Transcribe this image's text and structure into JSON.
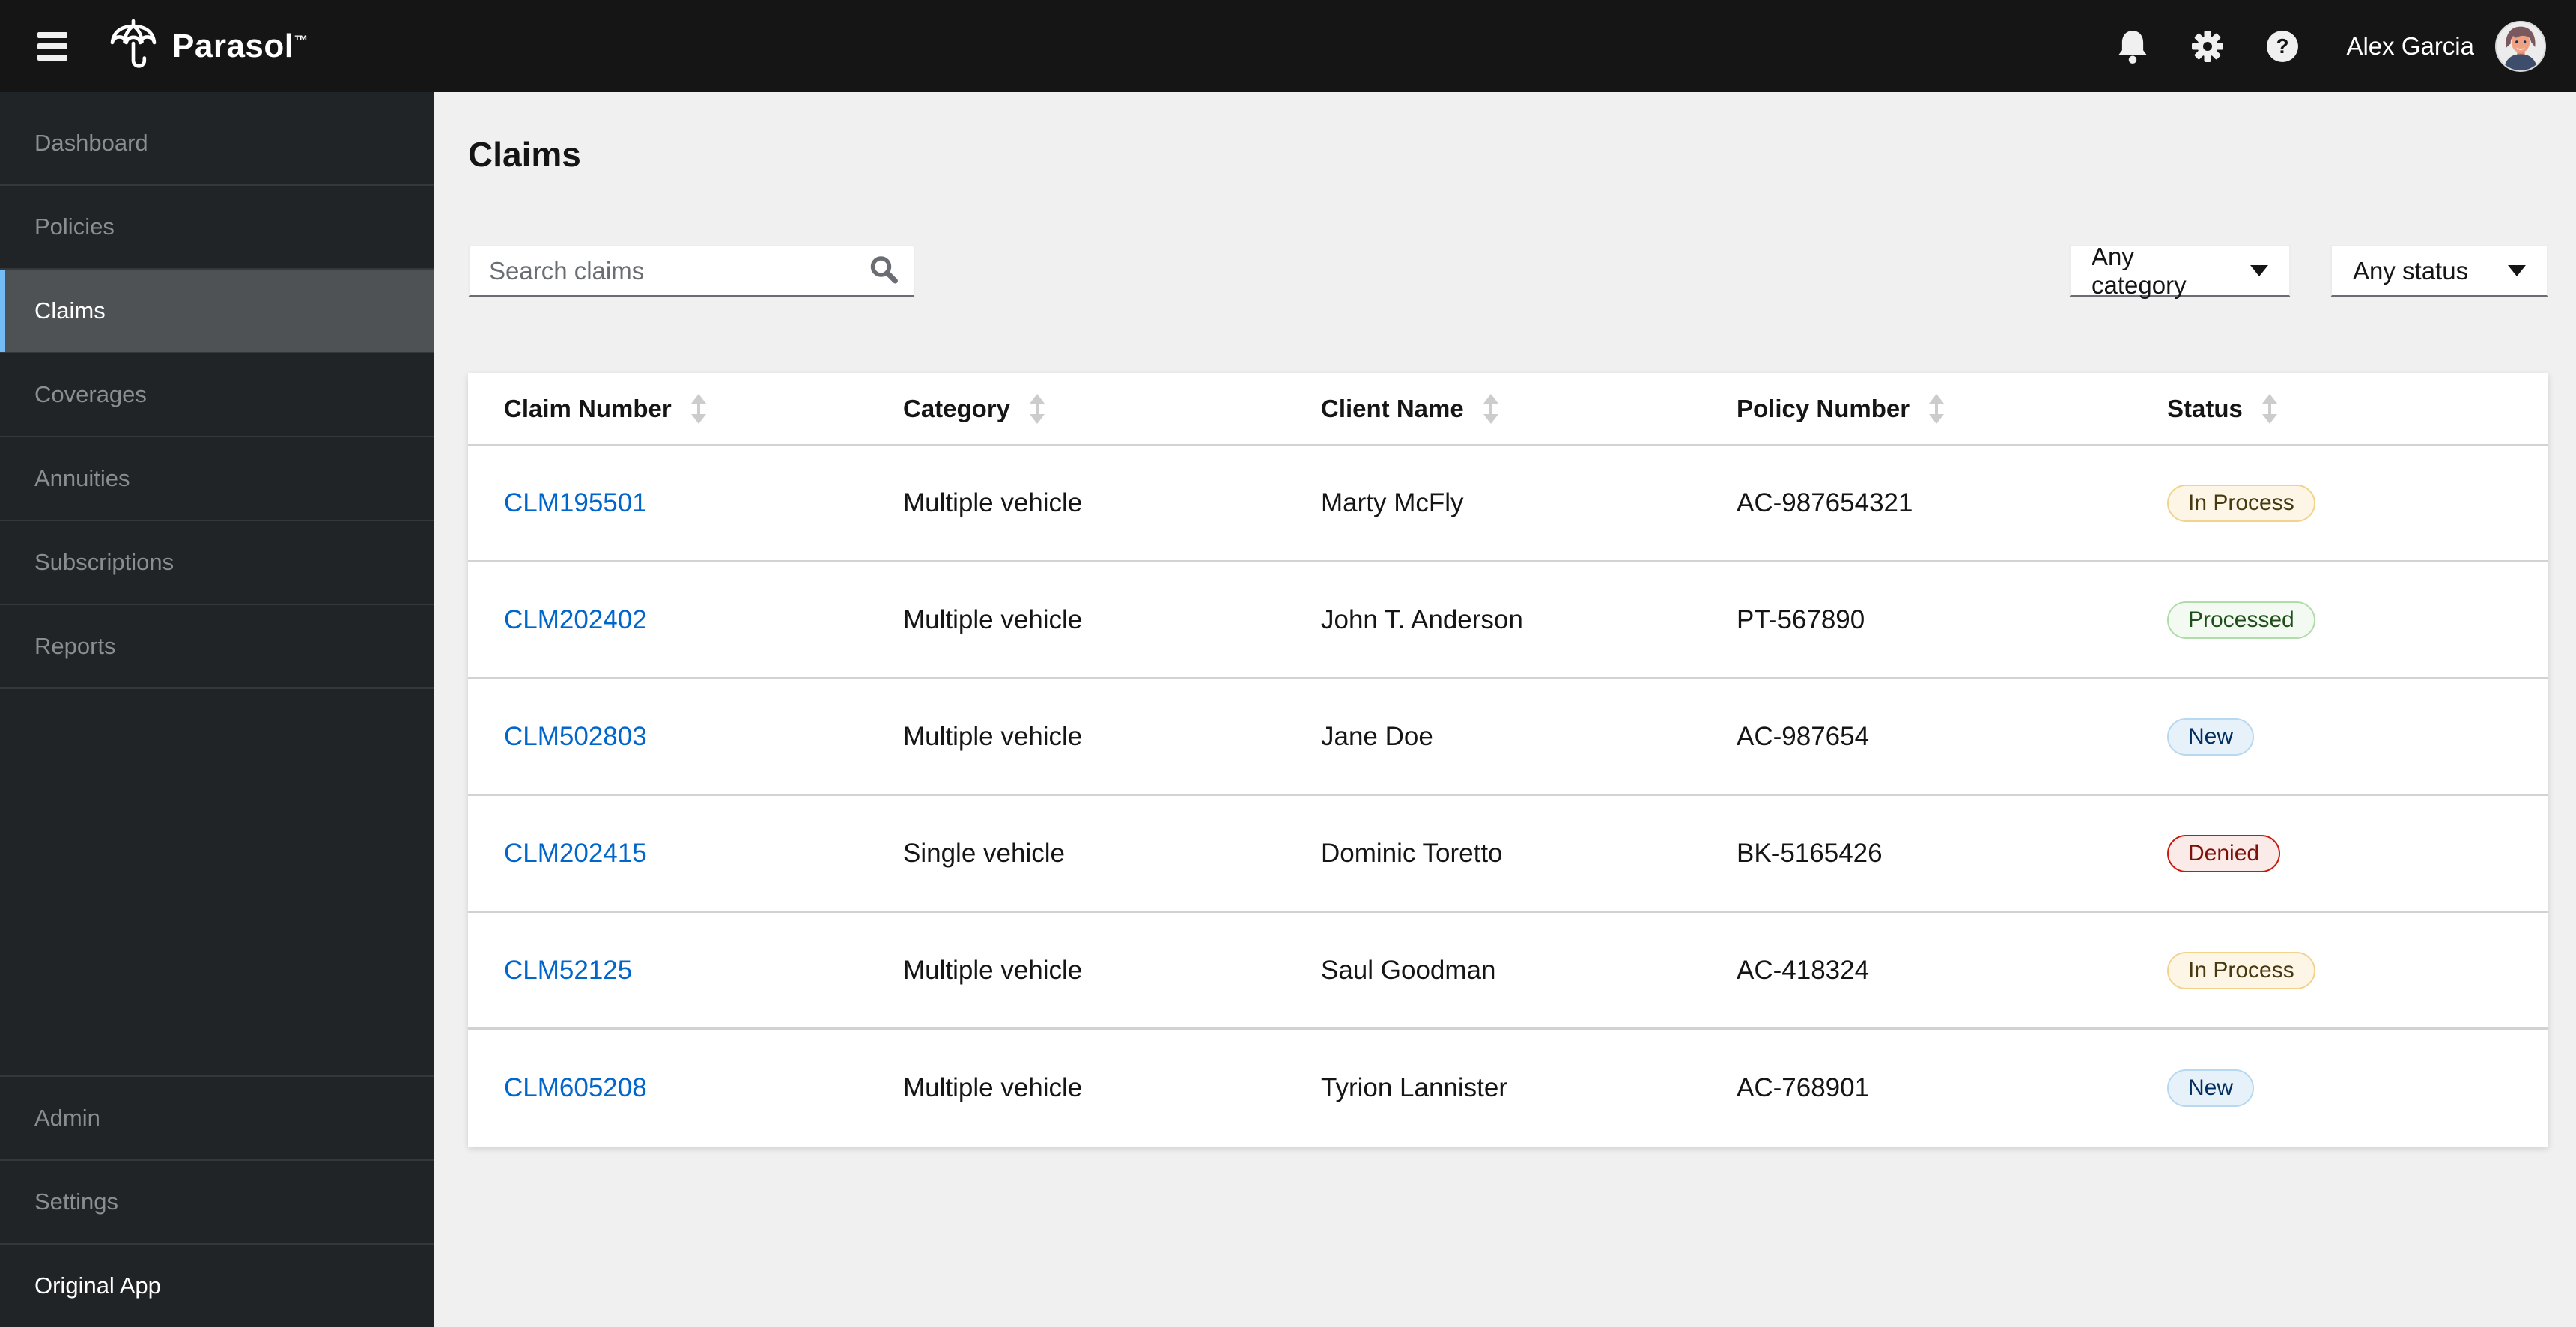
{
  "masthead": {
    "brand": "Parasol",
    "trademark": "™",
    "help_glyph": "?",
    "user": {
      "name": "Alex Garcia"
    }
  },
  "sidebar": {
    "items": [
      "Dashboard",
      "Policies",
      "Claims",
      "Coverages",
      "Annuities",
      "Subscriptions",
      "Reports"
    ],
    "selected": "Claims",
    "bottom_items": [
      "Admin",
      "Settings",
      "Original App"
    ]
  },
  "page": {
    "title": "Claims"
  },
  "toolbar": {
    "search_placeholder": "Search claims",
    "category_filter": "Any category",
    "status_filter": "Any status"
  },
  "table": {
    "columns": [
      "Claim Number",
      "Category",
      "Client Name",
      "Policy Number",
      "Status"
    ],
    "rows": [
      {
        "claim_number": "CLM195501",
        "category": "Multiple vehicle",
        "client_name": "Marty McFly",
        "policy_number": "AC-987654321",
        "status": "In Process",
        "status_variant": "gold"
      },
      {
        "claim_number": "CLM202402",
        "category": "Multiple vehicle",
        "client_name": "John T. Anderson",
        "policy_number": "PT-567890",
        "status": "Processed",
        "status_variant": "green"
      },
      {
        "claim_number": "CLM502803",
        "category": "Multiple vehicle",
        "client_name": "Jane Doe",
        "policy_number": "AC-987654",
        "status": "New",
        "status_variant": "blue"
      },
      {
        "claim_number": "CLM202415",
        "category": "Single vehicle",
        "client_name": "Dominic Toretto",
        "policy_number": "BK-5165426",
        "status": "Denied",
        "status_variant": "red"
      },
      {
        "claim_number": "CLM52125",
        "category": "Multiple vehicle",
        "client_name": "Saul Goodman",
        "policy_number": "AC-418324",
        "status": "In Process",
        "status_variant": "gold"
      },
      {
        "claim_number": "CLM605208",
        "category": "Multiple vehicle",
        "client_name": "Tyrion Lannister",
        "policy_number": "AC-768901",
        "status": "New",
        "status_variant": "blue"
      }
    ]
  },
  "colors": {
    "masthead_bg": "#151515",
    "sidebar_bg": "#212427",
    "sidebar_selected_bg": "#4f5255",
    "sidebar_accent": "#73bcf7",
    "page_bg": "#f0f0f0",
    "link": "#0066cc",
    "label_gold": {
      "bg": "#fdf6e6",
      "border": "#f2d38c",
      "text": "#473a10"
    },
    "label_green": {
      "bg": "#f3faf2",
      "border": "#b0dcaa",
      "text": "#1e4f18"
    },
    "label_blue": {
      "bg": "#e7f1fa",
      "border": "#b6d8f0",
      "text": "#002e5f"
    },
    "label_red": {
      "bg": "#faeae8",
      "border": "#c9190b",
      "text": "#7d1007"
    }
  }
}
